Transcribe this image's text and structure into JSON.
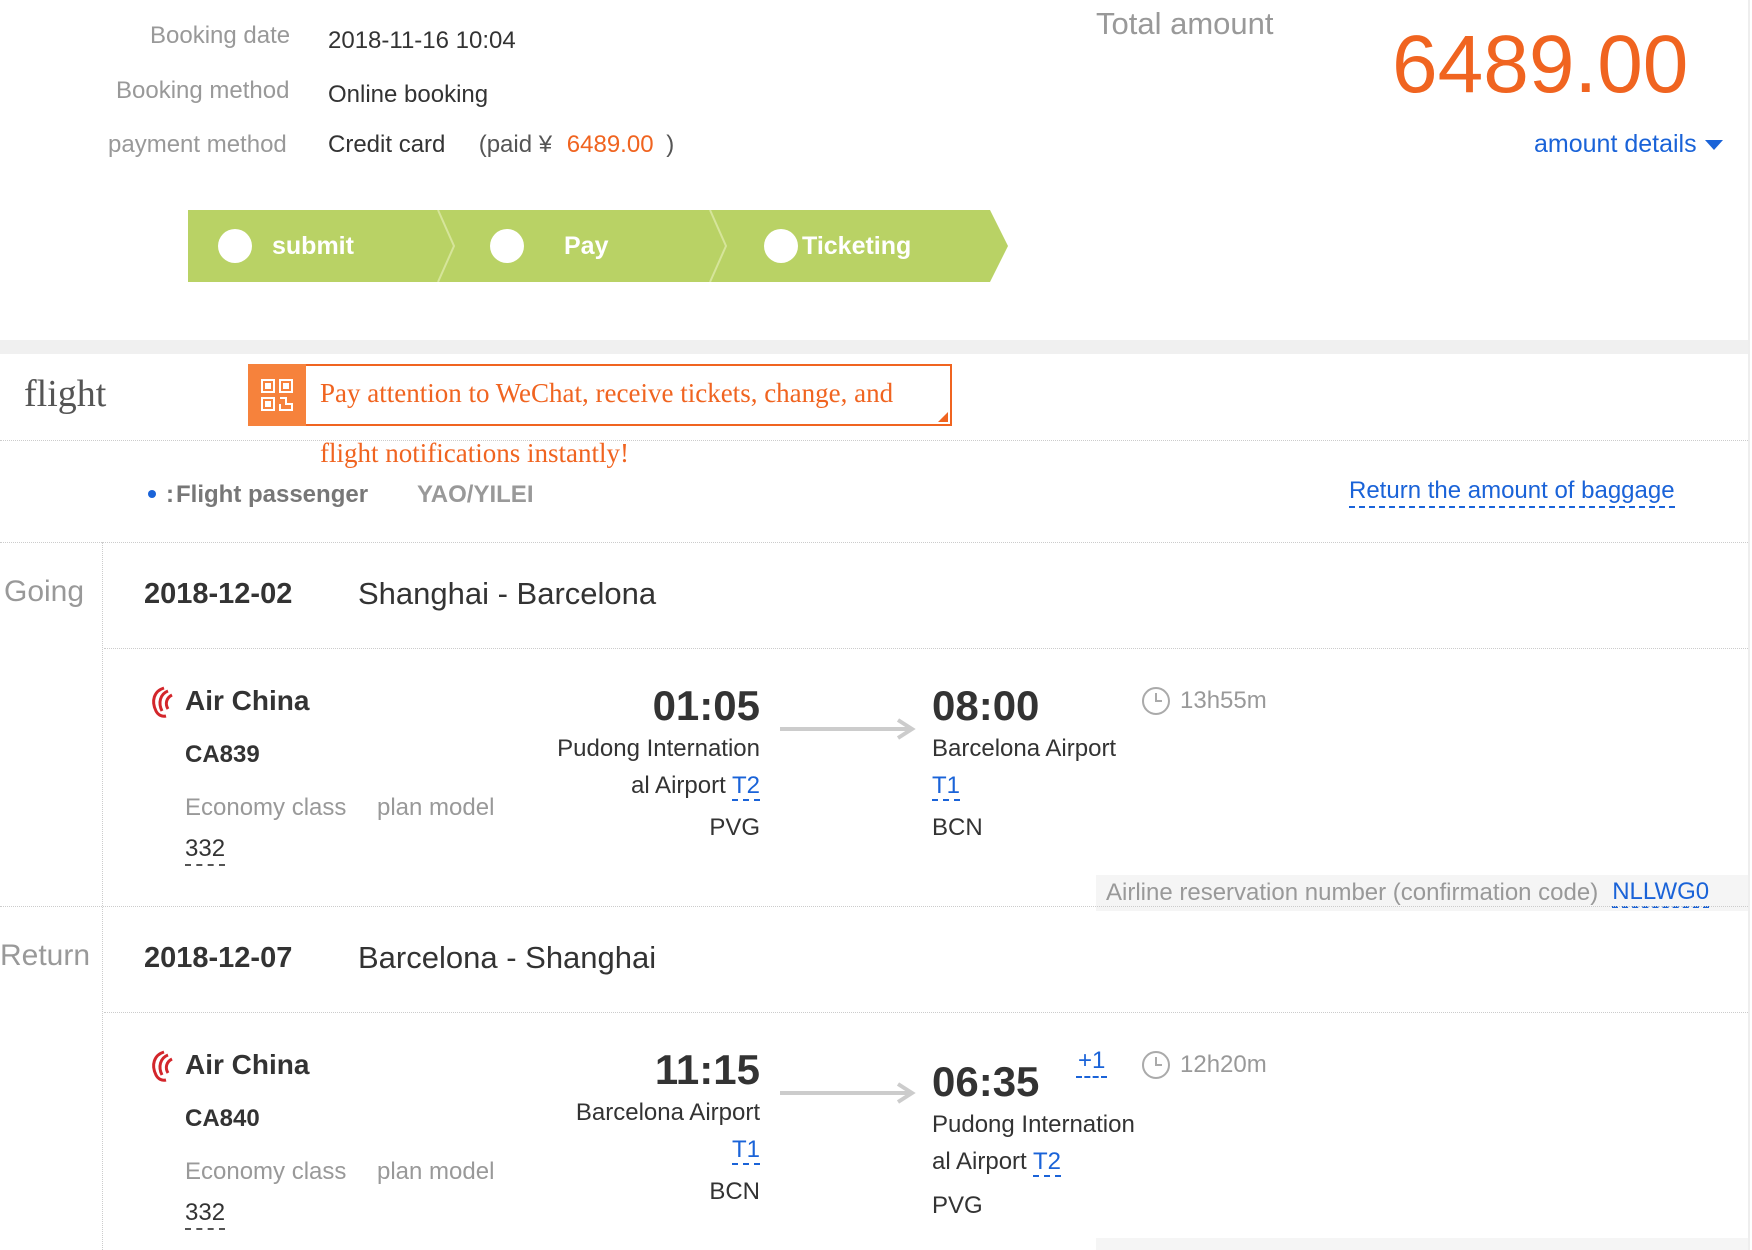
{
  "booking": {
    "date_label": "Booking date",
    "date_value": "2018-11-16 10:04",
    "method_label": "Booking method",
    "method_value": "Online booking",
    "payment_label": "payment method",
    "payment_value": "Credit card",
    "paid_prefix": "(paid ¥",
    "paid_amount": "6489.00",
    "paid_suffix": ")"
  },
  "total": {
    "label": "Total amount",
    "amount": "6489.00",
    "details_link": "amount details"
  },
  "progress": {
    "steps": [
      {
        "label": "submit",
        "done": true
      },
      {
        "label": "Pay",
        "done": true
      },
      {
        "label": "Ticketing",
        "done": true
      }
    ]
  },
  "flight_section": {
    "title": "flight",
    "wechat_notice_line1": "Pay attention to WeChat, receive tickets, change, and",
    "wechat_notice_line2": "flight notifications instantly!",
    "passenger_label": "Flight passenger",
    "passenger_name": "YAO/YILEI",
    "baggage_link": "Return the amount of baggage"
  },
  "segments": [
    {
      "label": "Going",
      "date": "2018-12-02",
      "route": "Shanghai - Barcelona",
      "airline": "Air China",
      "flight_no": "CA839",
      "cabin": "Economy class",
      "plane_label": "plan model",
      "plane_model": "332",
      "dep_time": "01:05",
      "dep_airport_line1": "Pudong Internation",
      "dep_airport_line2": "al Airport",
      "dep_terminal": "T2",
      "dep_code": "PVG",
      "arr_time": "08:00",
      "arr_airport_line1": "Barcelona Airport",
      "arr_terminal": "T1",
      "arr_code": "BCN",
      "duration": "13h55m",
      "confirmation_label": "Airline reservation number (confirmation code)",
      "confirmation_code": "NLLWG0"
    },
    {
      "label": "Return",
      "date": "2018-12-07",
      "route": "Barcelona - Shanghai",
      "airline": "Air China",
      "flight_no": "CA840",
      "cabin": "Economy class",
      "plane_label": "plan model",
      "plane_model": "332",
      "dep_time": "11:15",
      "dep_airport_line1": "Barcelona Airport",
      "dep_terminal": "T1",
      "dep_code": "BCN",
      "arr_time": "06:35",
      "arr_day_offset": "+1",
      "arr_airport_line1": "Pudong Internation",
      "arr_airport_line2": "al Airport",
      "arr_terminal": "T2",
      "arr_code": "PVG",
      "duration": "12h20m"
    }
  ],
  "colors": {
    "accent_orange": "#f06420",
    "progress_green": "#b9d265",
    "link_blue": "#1a63d8"
  }
}
